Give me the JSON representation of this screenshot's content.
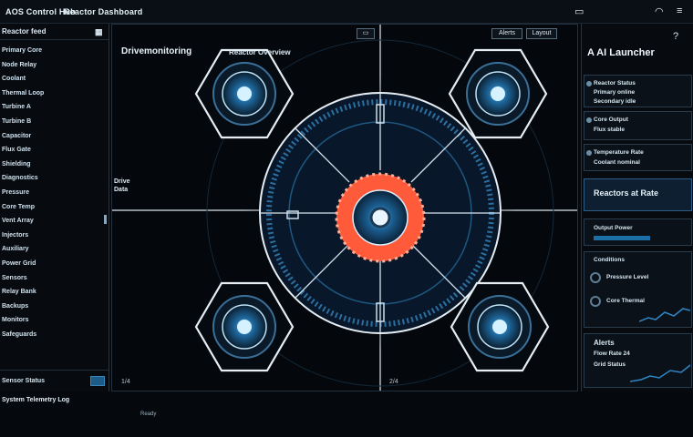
{
  "topbar": {
    "title": "AOS Control Hub",
    "subtitle": "Reactor Dashboard",
    "icons": [
      "window-icon",
      "wifi-icon",
      "menu-icon"
    ]
  },
  "sidebar": {
    "header": "Reactor feed",
    "header_icon": "grid-icon",
    "items": [
      "Primary Core",
      "Node Relay",
      "Coolant",
      "Thermal Loop",
      "Turbine A",
      "Turbine B",
      "Capacitor",
      "Flux Gate",
      "Shielding",
      "Diagnostics",
      "Pressure",
      "Core Temp",
      "Vent Array",
      "Injectors",
      "Auxiliary",
      "Power Grid",
      "Sensors",
      "Relay Bank",
      "Backups",
      "Monitors",
      "Safeguards"
    ],
    "footer_label": "Sensor Status",
    "footer_button": "OK"
  },
  "main": {
    "title": "Drivemonitoring",
    "subtitle": "Reactor Overview",
    "toolbar_buttons": [
      "▭",
      "Alerts",
      "Layout"
    ],
    "side_tab_line1": "Drive",
    "side_tab_line2": "Data",
    "footer_left": "1/4",
    "footer_right": "2/4"
  },
  "right_panel": {
    "title": "A AI Launcher",
    "cards": [
      {
        "lines": [
          "Reactor Status",
          "Primary online",
          "Secondary idle"
        ]
      },
      {
        "lines": [
          "Core Output",
          "Flux stable"
        ]
      },
      {
        "lines": [
          "Temperature Rate",
          "Coolant nominal"
        ]
      }
    ],
    "big_label": "Reactors at Rate",
    "stat_label": "Output Power",
    "gauges_label": "Conditions",
    "gauge_lines": [
      "Pressure Level",
      "Core Thermal"
    ],
    "alerts_label": "Alerts",
    "alert_lines": [
      "Flow Rate 24",
      "Grid Status"
    ],
    "progress": 0.62
  },
  "bottom": {
    "label": "System Telemetry Log",
    "hint": "Ready"
  },
  "colors": {
    "accent": "#2f86c4",
    "core": "#ff5a3a",
    "line": "#e6eef4"
  }
}
